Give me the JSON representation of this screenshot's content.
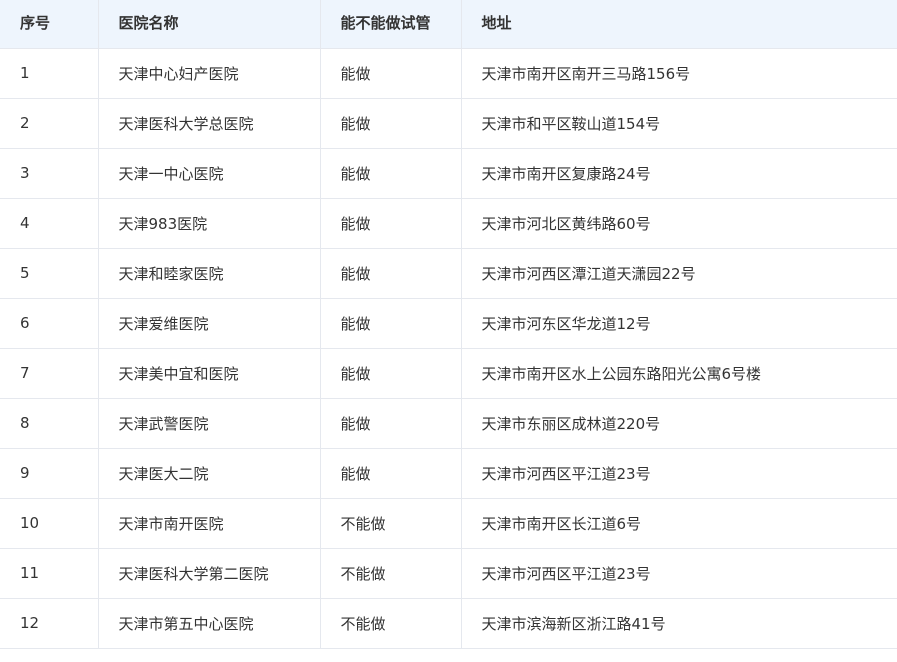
{
  "table": {
    "headers": [
      "序号",
      "医院名称",
      "能不能做试管",
      "地址"
    ],
    "rows": [
      [
        "1",
        "天津中心妇产医院",
        "能做",
        "天津市南开区南开三马路156号"
      ],
      [
        "2",
        "天津医科大学总医院",
        "能做",
        "天津市和平区鞍山道154号"
      ],
      [
        "3",
        "天津一中心医院",
        "能做",
        "天津市南开区复康路24号"
      ],
      [
        "4",
        "天津983医院",
        "能做",
        "天津市河北区黄纬路60号"
      ],
      [
        "5",
        "天津和睦家医院",
        "能做",
        "天津市河西区潭江道天潇园22号"
      ],
      [
        "6",
        "天津爱维医院",
        "能做",
        "天津市河东区华龙道12号"
      ],
      [
        "7",
        "天津美中宜和医院",
        "能做",
        "天津市南开区水上公园东路阳光公寓6号楼"
      ],
      [
        "8",
        "天津武警医院",
        "能做",
        "天津市东丽区成林道220号"
      ],
      [
        "9",
        "天津医大二院",
        "能做",
        "天津市河西区平江道23号"
      ],
      [
        "10",
        "天津市南开医院",
        "不能做",
        "天津市南开区长江道6号"
      ],
      [
        "11",
        "天津医科大学第二医院",
        "不能做",
        "天津市河西区平江道23号"
      ],
      [
        "12",
        "天津市第五中心医院",
        "不能做",
        "天津市滨海新区浙江路41号"
      ]
    ]
  }
}
